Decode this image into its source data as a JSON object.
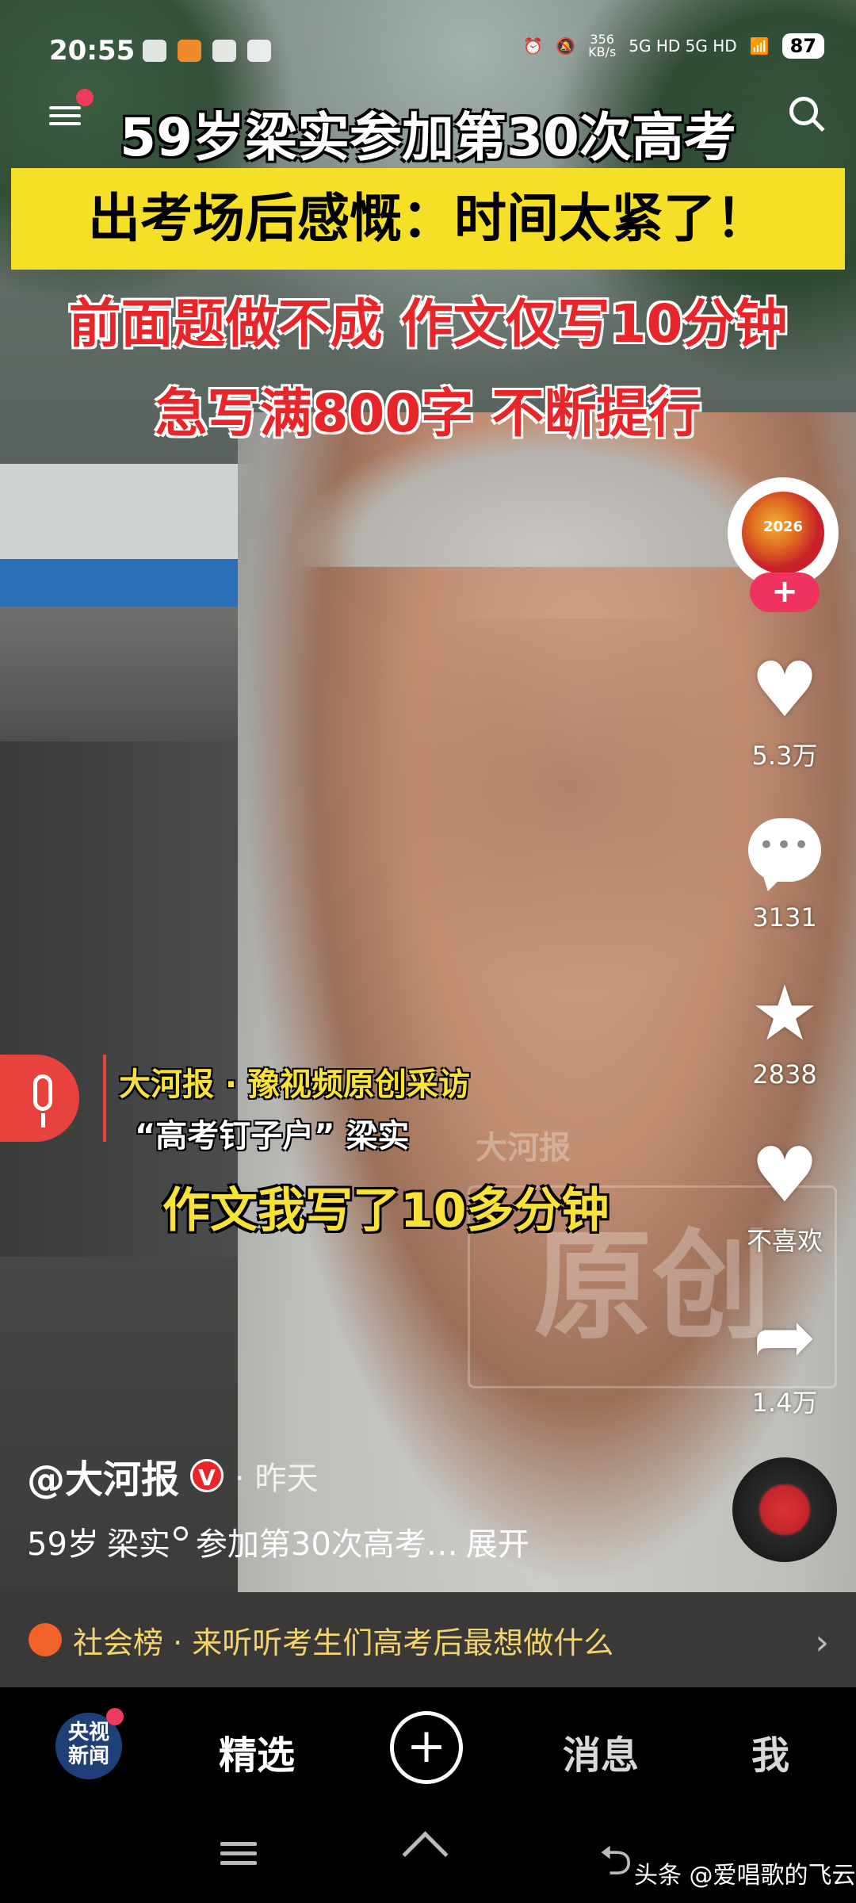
{
  "status_bar": {
    "time": "20:55",
    "speed_value": "356",
    "speed_unit": "KB/s",
    "network": "5G HD 5G HD",
    "battery": "87"
  },
  "overlay_titles": {
    "line1": "59岁梁实参加第30次高考",
    "line2": "出考场后感慨：时间太紧了！",
    "line3": "前面题做不成 作文仅写10分钟",
    "line4": "急写满800字 不断提行"
  },
  "captions": {
    "source": "大河报 · 豫视频原创采访",
    "speaker": "“高考钉子户” 梁实",
    "quote": "作文我写了10多分钟",
    "watermark": "原创",
    "watermark_logo": "大河报"
  },
  "avatar": {
    "year": "2026"
  },
  "actions": {
    "like_count": "5.3万",
    "comment_count": "3131",
    "favorite_count": "2838",
    "dislike_label": "不喜欢",
    "share_count": "1.4万"
  },
  "post": {
    "author": "@大河报",
    "verified": "V",
    "time": "· 昨天",
    "desc_pre": "59岁",
    "desc_tag": "梁实",
    "desc_post": "参加第30次高考…",
    "expand": "展开"
  },
  "hot_topic": {
    "text": "社会榜 · 来听听考生们高考后最想做什么"
  },
  "bottom_nav": {
    "logo_text": "央视\n新闻",
    "featured": "精选",
    "messages": "消息",
    "me": "我"
  },
  "credit": "头条 @爱唱歌的飞云"
}
